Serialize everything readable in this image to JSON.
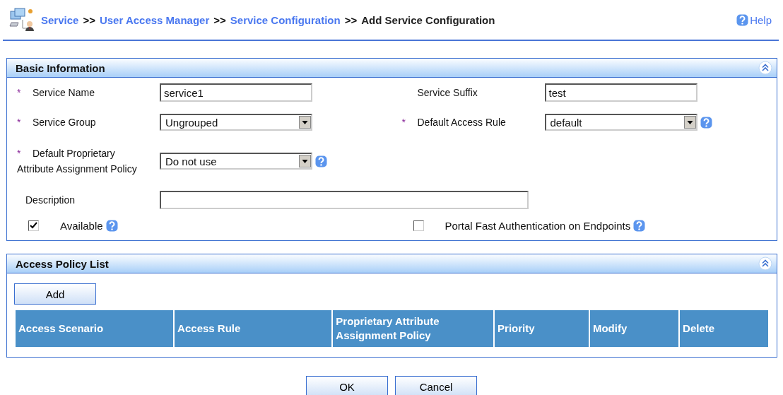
{
  "breadcrumb": [
    {
      "kind": "link",
      "text": "Service"
    },
    {
      "kind": "sep",
      "text": ">>"
    },
    {
      "kind": "link",
      "text": "User Access Manager"
    },
    {
      "kind": "sep",
      "text": ">>"
    },
    {
      "kind": "link",
      "text": "Service Configuration"
    },
    {
      "kind": "sep",
      "text": ">>"
    },
    {
      "kind": "current",
      "text": "Add Service Configuration"
    }
  ],
  "help": "Help",
  "basic_information": {
    "title": "Basic Information",
    "rows": [
      [
        {
          "kind": "text",
          "required_mark": "*",
          "label": "Service Name",
          "value": "service1"
        },
        {
          "kind": "text",
          "label": "Service Suffix",
          "value": "test"
        }
      ],
      [
        {
          "kind": "select",
          "required_mark": "*",
          "label": "Service Group",
          "value": "Ungrouped"
        },
        {
          "kind": "select",
          "required_mark": "*",
          "label": "Default Access Rule",
          "value": "default",
          "help": true
        }
      ],
      [
        {
          "kind": "select",
          "required_mark": "*",
          "label": "Default Proprietary Attribute Assignment Policy",
          "value": "Do not use",
          "help": true
        }
      ],
      [
        {
          "kind": "wide",
          "label": "Description"
        }
      ],
      [
        {
          "kind": "checkbox",
          "label": "Available",
          "checked": true,
          "help": true
        },
        {
          "kind": "checkbox",
          "label": "Portal Fast Authentication on Endpoints",
          "checked": false,
          "help": true
        }
      ]
    ]
  },
  "access_policy_list": {
    "title": "Access Policy List",
    "add_button": "Add",
    "columns": [
      "Access Scenario",
      "Access Rule",
      "Proprietary Attribute Assignment Policy",
      "Priority",
      "Modify",
      "Delete"
    ]
  },
  "buttons": [
    "OK",
    "Cancel"
  ]
}
